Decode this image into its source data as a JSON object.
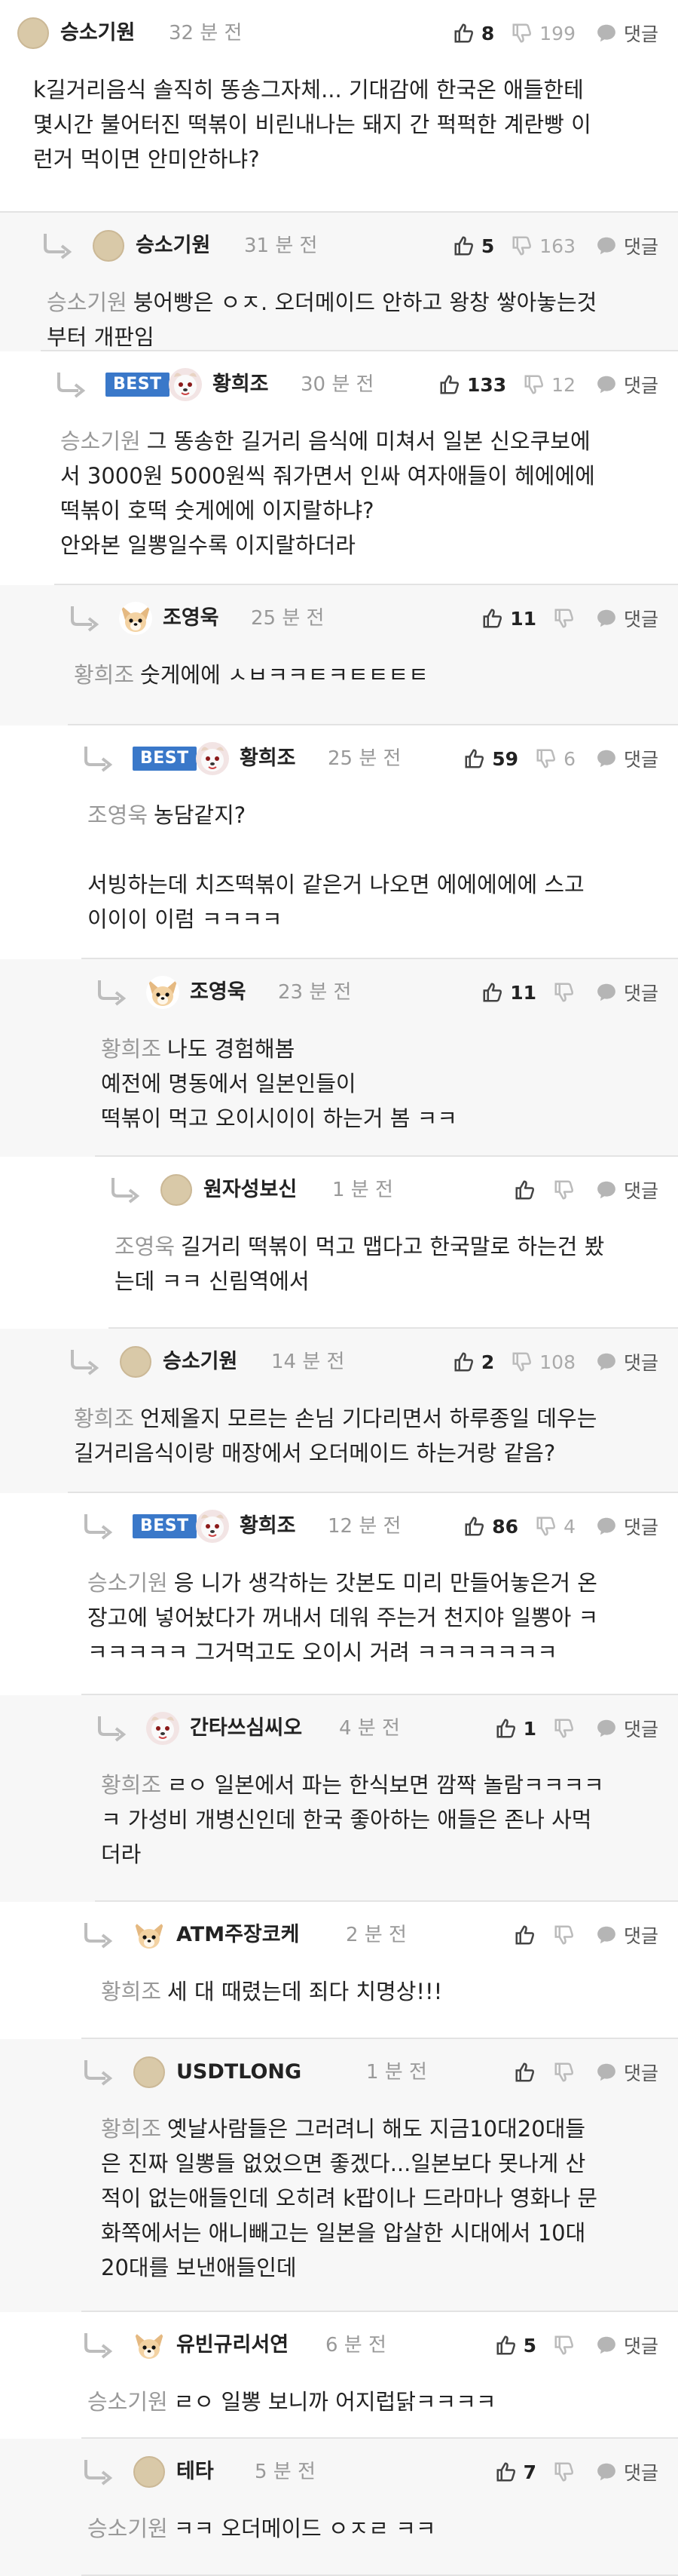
{
  "labels": {
    "reply": "댓글"
  },
  "comments": [
    {
      "author": "승소기원",
      "time": "32 분 전",
      "likes": "8",
      "dislikes": "199",
      "avatar": "beige-dot-icon",
      "best": false,
      "mention": "",
      "lines": [
        "k길거리음식 솔직히 똥송그자체... 기대감에 한국온 애들한테",
        "몇시간 불어터진 떡볶이 비린내나는 돼지 간 퍽퍽한 계란빵 이",
        "런거 먹이면 안미안하냐?"
      ]
    },
    {
      "author": "승소기원",
      "time": "31 분 전",
      "likes": "5",
      "dislikes": "163",
      "avatar": "beige-dot-icon",
      "best": false,
      "mention": "승소기원",
      "lines": [
        "붕어빵은 ㅇㅈ. 오더메이드 안하고 왕창 쌓아놓는것",
        "부터 개판임"
      ]
    },
    {
      "author": "황희조",
      "time": "30 분 전",
      "likes": "133",
      "dislikes": "12",
      "avatar": "dog-avatar-icon",
      "best": true,
      "mention": "승소기원",
      "lines": [
        "그 똥송한 길거리 음식에 미쳐서 일본 신오쿠보에",
        "서 3000원 5000원씩 줘가면서 인싸 여자애들이 헤에에에",
        "떡볶이 호떡 숫게에에 이지랄하냐?",
        "안와본 일뽕일수록 이지랄하더라"
      ]
    },
    {
      "author": "조영욱",
      "time": "25 분 전",
      "likes": "11",
      "dislikes": "",
      "avatar": "chihuahua-avatar-icon",
      "best": false,
      "mention": "황희조",
      "lines": [
        "숫게에에 ㅅㅂㅋㅋㅌㅋㅌㅌㅌㅌ"
      ]
    },
    {
      "author": "황희조",
      "time": "25 분 전",
      "likes": "59",
      "dislikes": "6",
      "avatar": "dog-avatar-icon",
      "best": true,
      "mention": "조영욱",
      "lines": [
        "농담같지?",
        "",
        "서빙하는데 치즈떡볶이 같은거 나오면 에에에에에 스고",
        "이이이 이럼 ㅋㅋㅋㅋ"
      ]
    },
    {
      "author": "조영욱",
      "time": "23 분 전",
      "likes": "11",
      "dislikes": "",
      "avatar": "chihuahua-avatar-icon",
      "best": false,
      "mention": "황희조",
      "lines": [
        "나도 경험해봄",
        "예전에 명동에서 일본인들이",
        "떡볶이 먹고 오이시이이 하는거 봄 ㅋㅋ"
      ]
    },
    {
      "author": "원자성보신",
      "time": "1 분 전",
      "likes": "",
      "dislikes": "",
      "avatar": "beige-dot-icon",
      "best": false,
      "mention": "조영욱",
      "lines": [
        "길거리 떡볶이 먹고 맵다고 한국말로 하는건 봤",
        "는데 ㅋㅋ 신림역에서"
      ]
    },
    {
      "author": "승소기원",
      "time": "14 분 전",
      "likes": "2",
      "dislikes": "108",
      "avatar": "beige-dot-icon",
      "best": false,
      "mention": "황희조",
      "lines": [
        "언제올지 모르는 손님 기다리면서 하루종일 데우는",
        "길거리음식이랑 매장에서 오더메이드 하는거랑 같음?"
      ]
    },
    {
      "author": "황희조",
      "time": "12 분 전",
      "likes": "86",
      "dislikes": "4",
      "avatar": "dog-avatar-icon",
      "best": true,
      "mention": "승소기원",
      "lines": [
        "응 니가 생각하는 갓본도 미리 만들어놓은거 온",
        "장고에 넣어놨다가 꺼내서 데워 주는거 천지야 일뽕아 ㅋ",
        "ㅋㅋㅋㅋㅋ 그거먹고도 오이시 거려 ㅋㅋㅋㅋㅋㅋㅋ"
      ]
    },
    {
      "author": "간타쓰심씨오",
      "time": "4 분 전",
      "likes": "1",
      "dislikes": "",
      "avatar": "dog-avatar-icon",
      "best": false,
      "mention": "황희조",
      "lines": [
        "ㄹㅇ 일본에서 파는 한식보면 깜짝 놀람ㅋㅋㅋㅋ",
        "ㅋ 가성비 개병신인데 한국 좋아하는 애들은 존나 사먹",
        "더라"
      ]
    },
    {
      "author": "ATM주장코케",
      "time": "2 분 전",
      "likes": "",
      "dislikes": "",
      "avatar": "chihuahua-avatar-icon",
      "best": false,
      "mention": "황희조",
      "lines": [
        "세 대 때렸는데 죄다 치명상!!!"
      ]
    },
    {
      "author": "USDTLONG",
      "time": "1 분 전",
      "likes": "",
      "dislikes": "",
      "avatar": "beige-dot-icon",
      "best": false,
      "mention": "황희조",
      "lines": [
        "옛날사람들은 그러려니 해도 지금10대20대들",
        "은 진짜 일뽕들 없었으면 좋겠다...일본보다 못나게 산",
        "적이 없는애들인데 오히려 k팝이나 드라마나 영화나 문",
        "화쪽에서는 애니빼고는 일본을 압살한 시대에서 10대",
        "20대를 보낸애들인데"
      ]
    },
    {
      "author": "유빈규리서연",
      "time": "6 분 전",
      "likes": "5",
      "dislikes": "",
      "avatar": "chihuahua-avatar-icon",
      "best": false,
      "mention": "승소기원",
      "lines": [
        "ㄹㅇ 일뽕 보니까 어지럽닭ㅋㅋㅋㅋ"
      ]
    },
    {
      "author": "테타",
      "time": "5 분 전",
      "likes": "7",
      "dislikes": "",
      "avatar": "beige-dot-icon",
      "best": false,
      "mention": "승소기원",
      "lines": [
        "ㅋㅋ 오더메이드 ㅇㅈㄹ ㅋㅋ"
      ]
    }
  ]
}
